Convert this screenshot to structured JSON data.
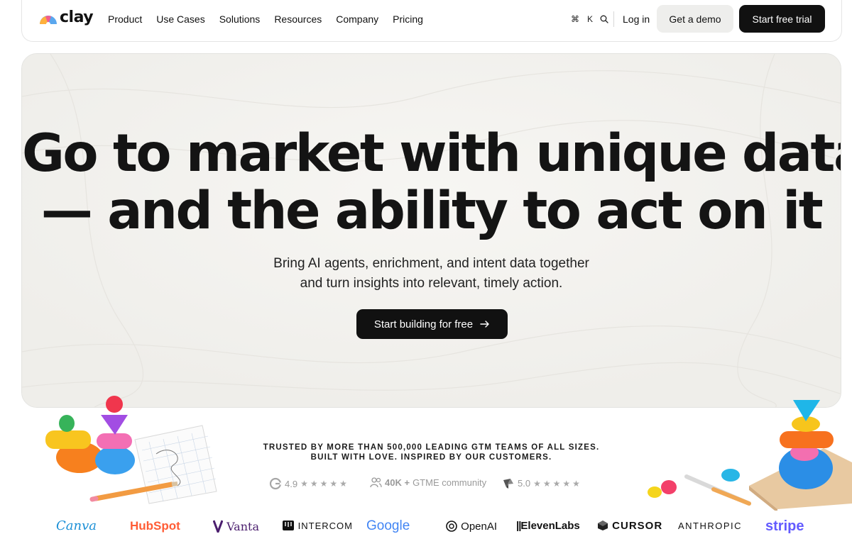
{
  "brand": {
    "name": "clay"
  },
  "nav": {
    "links": [
      "Product",
      "Use Cases",
      "Solutions",
      "Resources",
      "Company",
      "Pricing"
    ],
    "shortcut_cmd": "⌘",
    "shortcut_key": "K",
    "login": "Log in",
    "demo": "Get a demo",
    "trial": "Start free trial"
  },
  "hero": {
    "title_line1": "Go to market with unique data",
    "title_line2": "— and the ability to act on it",
    "subtitle_line1": "Bring AI agents, enrichment, and intent data together",
    "subtitle_line2": "and turn insights into relevant, timely action.",
    "cta": "Start building for free"
  },
  "trust": {
    "line1": "TRUSTED BY MORE THAN 500,000 LEADING GTM TEAMS OF ALL SIZES.",
    "line2": "BUILT WITH LOVE. INSPIRED BY OUR CUSTOMERS.",
    "g2_rating": "4.9",
    "community_count": "40K +",
    "community_label": "GTME community",
    "capterra_rating": "5.0",
    "stars": "★★★★★"
  },
  "customers": [
    "Canva",
    "HubSpot",
    "Vanta",
    "INTERCOM",
    "Google",
    "OpenAI",
    "ElevenLabs",
    "CURSOR",
    "ANTHROPIC",
    "stripe"
  ],
  "colors": {
    "primary_button": "#111111",
    "secondary_button": "#eeeeec",
    "hero_background": "#f4f3f0"
  }
}
